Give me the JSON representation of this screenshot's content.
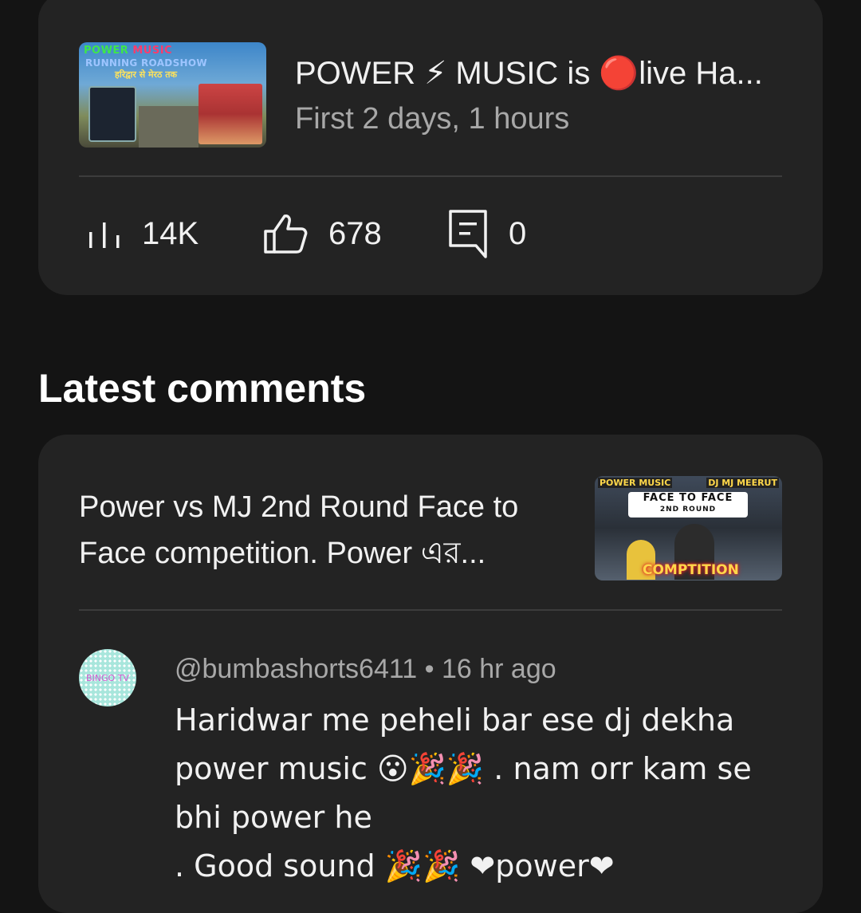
{
  "video_card": {
    "thumbnail": {
      "line1_a": "POWER",
      "line1_b": " MUSIC",
      "line2": "RUNNING ROADSHOW",
      "line3": "हरिद्वार से मेरठ तक"
    },
    "title": "POWER ⚡ MUSIC is 🔴live Ha...",
    "subtitle": "First 2 days, 1 hours",
    "stats": {
      "views": "14K",
      "likes": "678",
      "comments": "0"
    },
    "icons": {
      "views": "bar-chart-icon",
      "likes": "thumbs-up-icon",
      "comments": "comment-icon"
    }
  },
  "section": {
    "heading": "Latest comments"
  },
  "comment_card": {
    "video_title": "Power vs MJ 2nd Round Face to Face competition. Power এর...",
    "thumbnail": {
      "label_left": "POWER MUSIC",
      "label_right": "DJ MJ MEERUT",
      "banner_line1": "FACE TO FACE",
      "banner_line2": "2ND ROUND",
      "bottom_text": "COMPTITION"
    },
    "comment": {
      "avatar_text": "BINGO TV",
      "meta": "@bumbashorts6411 • 16 hr ago",
      "text": "Haridwar me peheli bar ese dj dekha power music 😮🎉🎉 . nam orr kam se bhi power he\n. Good sound 🎉🎉 ❤power❤"
    }
  }
}
